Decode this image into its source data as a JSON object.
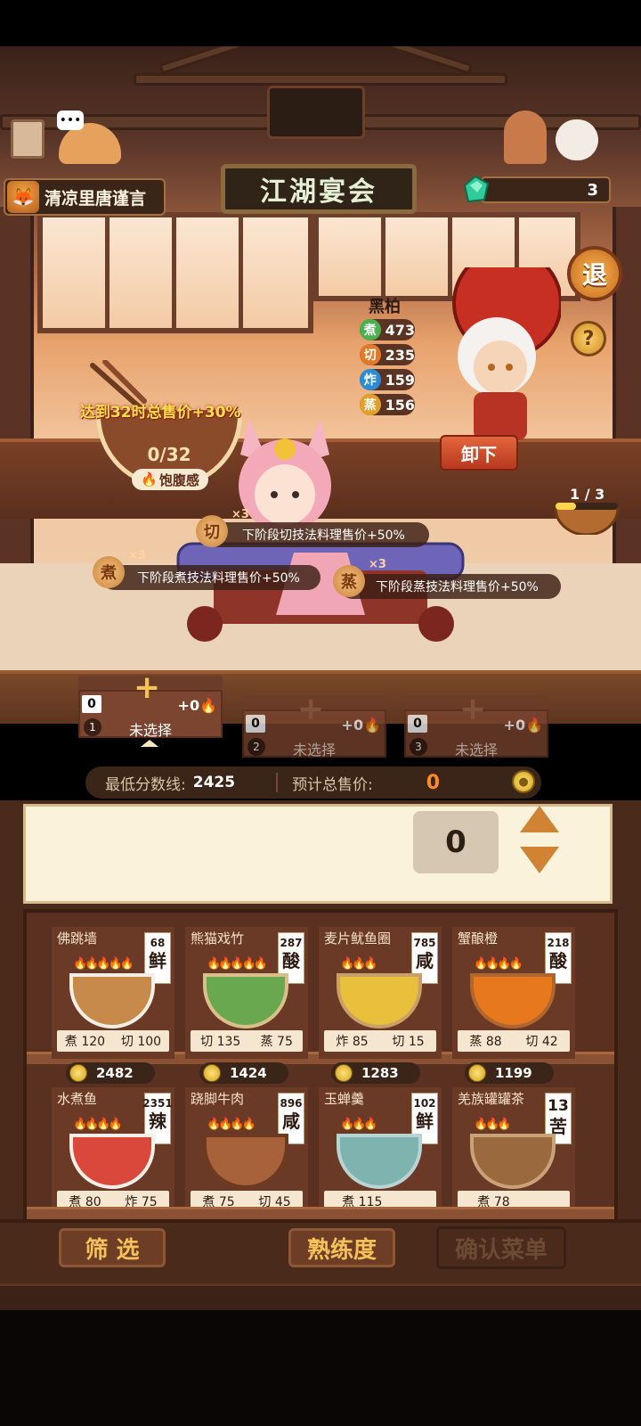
{
  "player": {
    "name": "清凉里唐谨言"
  },
  "event": {
    "title": "江湖宴会"
  },
  "gems": {
    "count": "3"
  },
  "buttons": {
    "exit": "退",
    "help": "?",
    "unload": "卸下",
    "filter": "筛 选",
    "proficiency": "熟练度",
    "confirm": "确认菜单"
  },
  "chef": {
    "name": "黑柏",
    "stats": [
      {
        "skill": "煮",
        "value": "473",
        "color": "#4caf50"
      },
      {
        "skill": "切",
        "value": "235",
        "color": "#e07a2b"
      },
      {
        "skill": "炸",
        "value": "159",
        "color": "#2b8bd6"
      },
      {
        "skill": "蒸",
        "value": "156",
        "color": "#e0a02b"
      }
    ]
  },
  "progress": {
    "label": "1 / 3"
  },
  "satiety": {
    "bonus": "达到32时总售价+30%",
    "value": "0/32",
    "label": "饱腹感"
  },
  "tips": [
    {
      "icon": "切",
      "mult": "×3",
      "text": "下阶段切技法料理售价+50%"
    },
    {
      "icon": "煮",
      "mult": "×3",
      "text": "下阶段煮技法料理售价+50%"
    },
    {
      "icon": "蒸",
      "mult": "×3",
      "text": "下阶段蒸技法料理售价+50%"
    }
  ],
  "slots": [
    {
      "count": "0",
      "fire": "+0",
      "index": "1",
      "label": "未选择"
    },
    {
      "count": "0",
      "fire": "+0",
      "index": "2",
      "label": "未选择"
    },
    {
      "count": "0",
      "fire": "+0",
      "index": "3",
      "label": "未选择"
    }
  ],
  "score": {
    "min_label": "最低分数线:",
    "min_value": "2425",
    "total_label": "预计总售价:",
    "total_value": "0"
  },
  "quantity": "0",
  "dishes": [
    {
      "name": "佛跳墙",
      "score": "68",
      "taste": "鲜",
      "flames": "🔥🔥🔥🔥🔥",
      "s1": "煮",
      "v1": "120",
      "s2": "切",
      "v2": "100",
      "price": "2482",
      "color": "#c88a4a"
    },
    {
      "name": "熊猫戏竹",
      "score": "287",
      "taste": "酸",
      "flames": "🔥🔥🔥🔥🔥",
      "s1": "切",
      "v1": "135",
      "s2": "蒸",
      "v2": "75",
      "price": "1424",
      "color": "#6aa84f"
    },
    {
      "name": "麦片鱿鱼圈",
      "score": "785",
      "taste": "咸",
      "flames": "🔥🔥🔥",
      "s1": "炸",
      "v1": "85",
      "s2": "切",
      "v2": "15",
      "price": "1283",
      "color": "#e8c03c"
    },
    {
      "name": "蟹酿橙",
      "score": "218",
      "taste": "酸",
      "flames": "🔥🔥🔥🔥",
      "s1": "蒸",
      "v1": "88",
      "s2": "切",
      "v2": "42",
      "price": "1199",
      "color": "#e8781e"
    },
    {
      "name": "水煮鱼",
      "score": "2351",
      "taste": "辣",
      "flames": "🔥🔥🔥🔥",
      "s1": "煮",
      "v1": "80",
      "s2": "炸",
      "v2": "75",
      "color": "#d9483a"
    },
    {
      "name": "跷脚牛肉",
      "score": "896",
      "taste": "咸",
      "flames": "🔥🔥🔥🔥",
      "s1": "煮",
      "v1": "75",
      "s2": "切",
      "v2": "45",
      "color": "#a8623a"
    },
    {
      "name": "玉蝉羹",
      "score": "102",
      "taste": "鲜",
      "flames": "🔥🔥🔥",
      "s1": "煮",
      "v1": "115",
      "s2": "",
      "v2": "",
      "color": "#7fb3b0"
    },
    {
      "name": "羌族罐罐茶",
      "score": "13",
      "taste": "苦",
      "flames": "🔥🔥🔥",
      "s1": "煮",
      "v1": "78",
      "s2": "",
      "v2": "",
      "color": "#9a6a3e"
    }
  ]
}
